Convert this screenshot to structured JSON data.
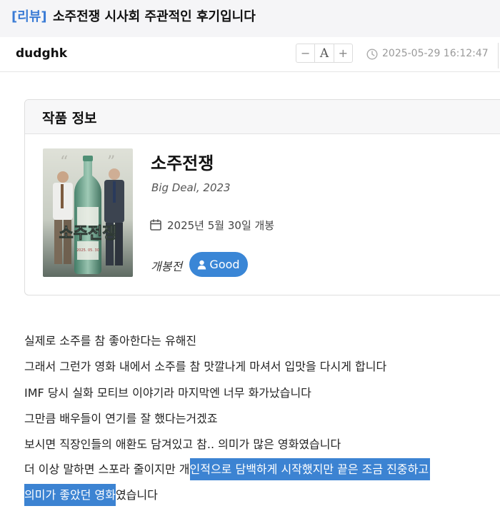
{
  "post": {
    "category": "[리뷰]",
    "title": "소주전쟁 시사회 주관적인 후기입니다",
    "author": "dudghk",
    "datetime": "2025-05-29 16:12:47"
  },
  "font_controls": {
    "decrease": "−",
    "font": "A",
    "increase": "+"
  },
  "info_card": {
    "heading": "작품 정보",
    "movie_title": "소주전쟁",
    "english_title": "Big Deal, 2023",
    "release_date": "2025년 5월 30일  개봉",
    "pre_release_label": "개봉전",
    "rating_badge": "Good",
    "poster_title": "소주전쟁",
    "poster_date": "2025. 05. 30"
  },
  "body": {
    "lines": [
      "실제로 소주를 참 좋아한다는 유해진",
      "그래서 그런가 영화 내에서 소주를 참 맛깔나게 마셔서 입맛을 다시게 합니다",
      "IMF 당시 실화 모티브 이야기라 마지막엔 너무 화가났습니다",
      "그만큼 배우들이 연기를 잘 했다는거겠죠",
      "보시면 직장인들의 애환도 담겨있고 참.. 의미가 많은 영화였습니다"
    ],
    "line6_plain": "더 이상 말하면 스포라 줄이지만 개",
    "line6_selected": "인적으로 담백하게 시작했지만 끝은 조금 진중하고",
    "line7_selected": "의미가 좋았던 영화",
    "line7_plain": "였습니다"
  },
  "colors": {
    "accent": "#3a7bd5",
    "selection": "#3c83d2",
    "badge": "#3a86d6"
  },
  "icons": {
    "clock": "clock-icon",
    "calendar": "calendar-icon",
    "user": "user-icon"
  }
}
